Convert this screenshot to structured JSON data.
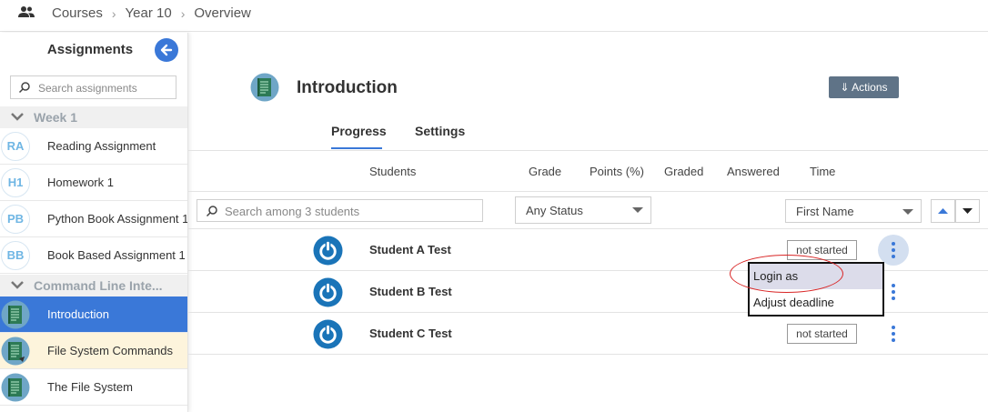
{
  "breadcrumb": {
    "items": [
      "Courses",
      "Year 10",
      "Overview"
    ]
  },
  "sidebar": {
    "title": "Assignments",
    "search_placeholder": "Search assignments",
    "sections": [
      {
        "label": "Week 1"
      },
      {
        "label": "Command Line Inte..."
      }
    ],
    "items": [
      {
        "badge": "RA",
        "label": "Reading Assignment"
      },
      {
        "badge": "H1",
        "label": "Homework 1"
      },
      {
        "badge": "PB",
        "label": "Python Book Assignment 1"
      },
      {
        "badge": "BB",
        "label": "Book Based Assignment 1"
      },
      {
        "label": "Introduction"
      },
      {
        "label": "File System Commands"
      },
      {
        "label": "The File System"
      }
    ]
  },
  "main": {
    "title": "Introduction",
    "actions_label": "⇓ Actions",
    "tabs": [
      {
        "label": "Progress"
      },
      {
        "label": "Settings"
      }
    ],
    "columns": [
      "Students",
      "Grade",
      "Points (%)",
      "Graded",
      "Answered",
      "Time"
    ],
    "filters": {
      "student_search_placeholder": "Search among 3 students",
      "status_value": "Any Status",
      "sort_value": "First Name"
    },
    "students": [
      {
        "name": "Student A Test",
        "status": "not started"
      },
      {
        "name": "Student B Test",
        "status": ""
      },
      {
        "name": "Student C Test",
        "status": "not started"
      }
    ],
    "row_menu": {
      "items": [
        "Login as",
        "Adjust deadline"
      ]
    }
  },
  "colors": {
    "accent": "#3a78d8",
    "actions_button": "#5f7387",
    "highlight_row": "#fdf4dc",
    "annotation": "#d92626"
  }
}
